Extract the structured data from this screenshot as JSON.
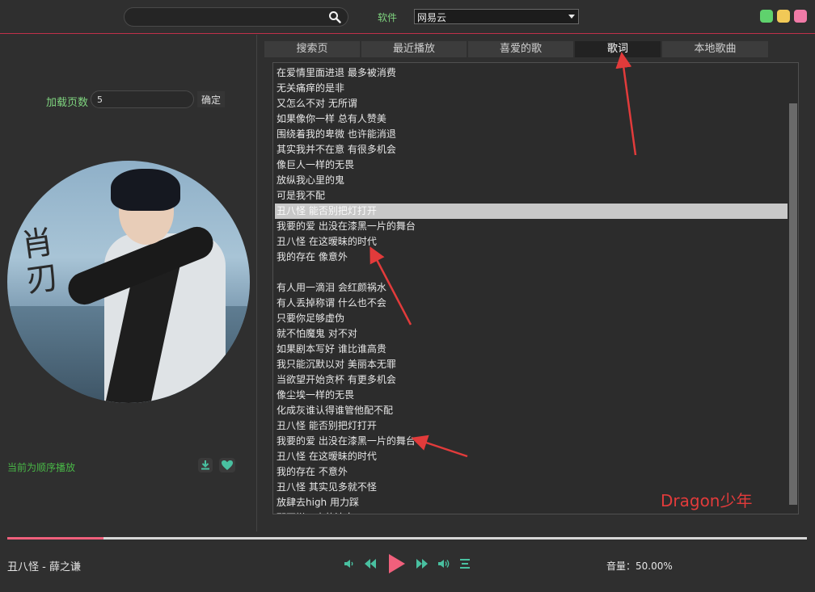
{
  "header": {
    "search_value": "",
    "software_label": "软件",
    "source_value": "网易云",
    "colors": {
      "minimize": "#5fd26d",
      "maximize": "#f1c957",
      "close": "#f07aa7",
      "accent_line": "#c0304a"
    }
  },
  "left": {
    "load_pages_label": "加载页数",
    "load_pages_value": "5",
    "confirm_label": "确定",
    "cover_calligraphy": "肖刃",
    "play_mode": "当前为顺序播放"
  },
  "tabs": [
    {
      "label": "搜索页"
    },
    {
      "label": "最近播放"
    },
    {
      "label": "喜爱的歌"
    },
    {
      "label": "歌词"
    },
    {
      "label": "本地歌曲"
    }
  ],
  "lyrics": [
    "在爱情里面进退 最多被消费",
    "无关痛痒的是非",
    "又怎么不对 无所谓",
    "如果像你一样 总有人赞美",
    "围绕着我的卑微 也许能消退",
    "其实我并不在意 有很多机会",
    "像巨人一样的无畏",
    "放纵我心里的鬼",
    "可是我不配",
    "丑八怪 能否别把灯打开",
    "我要的爱 出没在漆黑一片的舞台",
    "丑八怪 在这暧昧的时代",
    "我的存在 像意外",
    "",
    "有人用一滴泪 会红颜祸水",
    "有人丢掉称谓 什么也不会",
    "只要你足够虚伪",
    "就不怕魔鬼 对不对",
    "如果剧本写好 谁比谁高贵",
    "我只能沉默以对 美丽本无罪",
    "当欲望开始贪杯 有更多机会",
    "像尘埃一样的无畏",
    "化成灰谁认得谁管他配不配",
    "丑八怪 能否别把灯打开",
    "我要的爱 出没在漆黑一片的舞台",
    "丑八怪 在这暧昧的时代",
    "我的存在 不意外",
    "丑八怪 其实见多就不怪",
    "放肆去high 用力踩",
    "那不堪一击的洁白"
  ],
  "current_lyric_index": 9,
  "watermark": "Dragon少年",
  "player": {
    "now_playing": "丑八怪 - 薛之谦",
    "progress": 0.12,
    "volume_label": "音量：50.00%",
    "accent_color": "#f0607c",
    "control_color": "#49c0a0"
  },
  "icons": [
    "search-icon",
    "download-icon",
    "heart-icon",
    "volume-low-icon",
    "previous-icon",
    "play-icon",
    "next-icon",
    "volume-high-icon",
    "playlist-icon"
  ]
}
